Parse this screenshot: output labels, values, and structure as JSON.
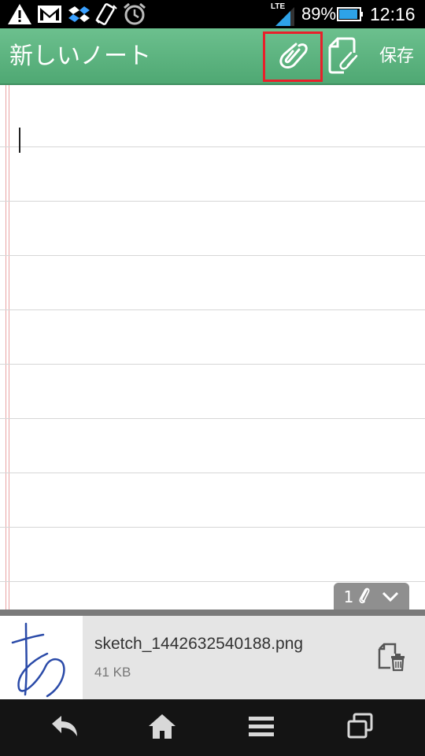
{
  "status_bar": {
    "network": "LTE",
    "battery": "89%",
    "time": "12:16",
    "left_icons": [
      "warning-icon",
      "gmail-icon",
      "dropbox-icon",
      "screen-rotate-icon",
      "alarm-icon"
    ],
    "signal_level": 0.8,
    "battery_level": 0.89
  },
  "action_bar": {
    "title": "新しいノート",
    "attach_icon": "paperclip-icon",
    "add_file_icon": "attach-file-icon",
    "save_label": "保存",
    "colors": {
      "bar": "#5bb27f",
      "highlight": "#e8202a"
    }
  },
  "note": {
    "page_count": "1",
    "tab_icons": [
      "paperclip-icon",
      "chevron-down-icon"
    ]
  },
  "attachment": {
    "file_name": "sketch_1442632540188.png",
    "file_size": "41 KB",
    "delete_icon": "delete-attachment-icon"
  },
  "nav_bar": {
    "buttons": [
      "back-icon",
      "home-icon",
      "menu-icon",
      "recent-apps-icon"
    ]
  }
}
